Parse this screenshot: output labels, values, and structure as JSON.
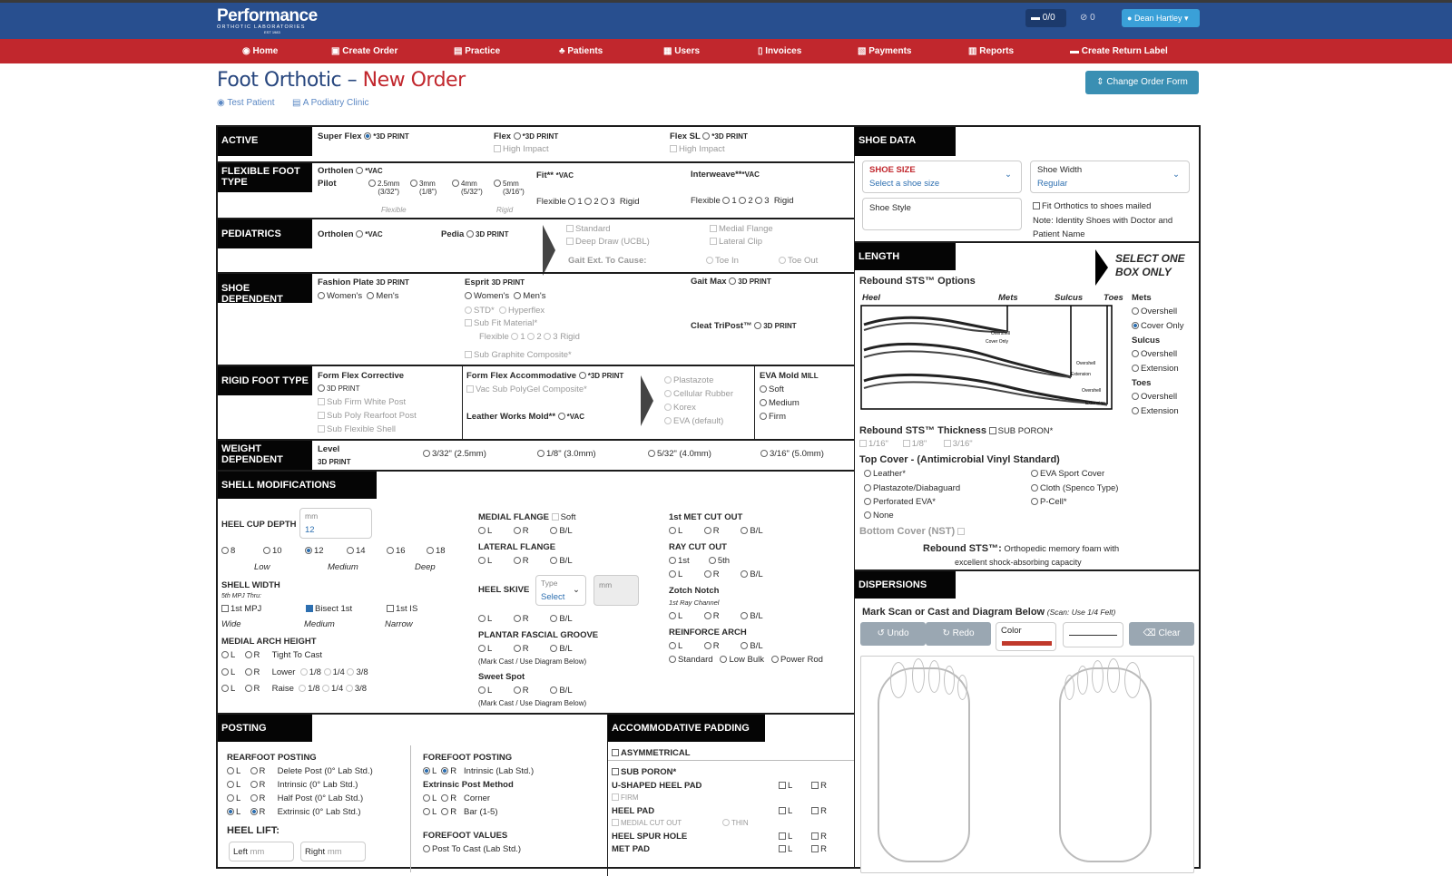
{
  "topbar": {
    "logo_line1": "Performance",
    "logo_line2": "ORTHOTIC LABORATORIES",
    "logo_line3": "EST 1983",
    "shipments": "0/0",
    "notifications": "0",
    "user": "Dean Hartley"
  },
  "nav": [
    "Home",
    "Create Order",
    "Practice",
    "Patients",
    "Users",
    "Invoices",
    "Payments",
    "Reports",
    "Create Return Label"
  ],
  "page": {
    "title": "Foot Orthotic",
    "subtitle": "New Order",
    "dash": "–",
    "patient": "Test Patient",
    "clinic": "A Podiatry Clinic",
    "change_form": "Change Order Form"
  },
  "active": {
    "header": "ACTIVE",
    "superflex": "Super Flex",
    "superflex_tag": "*3D PRINT",
    "flex": "Flex",
    "flex_tag": "*3D PRINT",
    "flexsl": "Flex SL",
    "flexsl_tag": "*3D PRINT",
    "high_impact": "High Impact"
  },
  "flexible": {
    "header": "FLEXIBLE FOOT TYPE",
    "ortholen": "Ortholen",
    "vac": "*VAC",
    "pilot": "Pilot",
    "m1": "2.5mm",
    "m1b": "(3/32\")",
    "m2": "3mm",
    "m2b": "(1/8\")",
    "m3": "4mm",
    "m3b": "(5/32\")",
    "m4": "5mm",
    "m4b": "(3/16\")",
    "flexible": "Flexible",
    "rigid": "Rigid",
    "fit": "Fit**",
    "fit_tag": "*VAC",
    "interweave": "Interweave**",
    "interweave_tag": "*VAC",
    "n1": "1",
    "n2": "2",
    "n3": "3"
  },
  "pediatrics": {
    "header": "PEDIATRICS",
    "ortholen": "Ortholen",
    "vac": "*VAC",
    "pedia": "Pedia",
    "pedia_tag": "3D PRINT",
    "standard": "Standard",
    "deep": "Deep Draw (UCBL)",
    "medial_flange": "Medial Flange",
    "lateral_clip": "Lateral Clip",
    "gait": "Gait Ext. To Cause:",
    "toe_in": "Toe In",
    "toe_out": "Toe Out"
  },
  "shoe_dep": {
    "header": "SHOE DEPENDENT",
    "fashion": "Fashion Plate",
    "print": "3D PRINT",
    "womens": "Women's",
    "mens": "Men's",
    "esprit": "Esprit",
    "std": "STD*",
    "hyperflex": "Hyperflex",
    "subfit": "Sub Fit Material*",
    "flexible": "Flexible",
    "rigid": "Rigid",
    "graphite": "Sub Graphite Composite*",
    "gaitmax": "Gait Max",
    "cleat": "Cleat TriPost™",
    "n1": "1",
    "n2": "2",
    "n3": "3"
  },
  "rigid": {
    "header": "RIGID FOOT TYPE",
    "formflex": "Form Flex Corrective",
    "print": "3D PRINT",
    "white": "Sub Firm White Post",
    "poly": "Sub Poly Rearfoot Post",
    "shell": "Sub Flexible Shell",
    "accom": "Form Flex Accommodative",
    "accom_tag": "*3D PRINT",
    "polygel": "Vac Sub PolyGel Composite*",
    "leather": "Leather Works Mold**",
    "vac": "*VAC",
    "plastazote": "Plastazote",
    "cellular": "Cellular Rubber",
    "korex": "Korex",
    "eva": "EVA (default)",
    "evamold": "EVA Mold",
    "mill": "MILL",
    "soft": "Soft",
    "medium": "Medium",
    "firm": "Firm"
  },
  "weight": {
    "header": "WEIGHT DEPENDENT",
    "level": "Level",
    "print": "3D PRINT",
    "o1": "3/32\" (2.5mm)",
    "o2": "1/8\" (3.0mm)",
    "o3": "5/32\" (4.0mm)",
    "o4": "3/16\" (5.0mm)"
  },
  "shellmod": {
    "header": "SHELL MODIFICATIONS",
    "heelcup": "HEEL CUP DEPTH",
    "mm": "mm",
    "heelcup_val": "12",
    "depths": [
      "8",
      "10",
      "12",
      "14",
      "16",
      "18"
    ],
    "low": "Low",
    "medium": "Medium",
    "deep": "Deep",
    "shellwidth": "SHELL WIDTH",
    "mpj": "5th MPJ Thru:",
    "w1": "1st MPJ",
    "w2": "Bisect 1st",
    "w3": "1st IS",
    "wide": "Wide",
    "narrow": "Narrow",
    "arch": "MEDIAL ARCH HEIGHT",
    "L": "L",
    "R": "R",
    "tight": "Tight To Cast",
    "lower": "Lower",
    "raise": "Raise",
    "f1": "1/8",
    "f2": "1/4",
    "f3": "3/8",
    "medflange": "MEDIAL FLANGE",
    "soft": "Soft",
    "BL": "B/L",
    "latflange": "LATERAL FLANGE",
    "skive": "HEEL SKIVE",
    "type": "Type",
    "select": "Select",
    "plantar": "PLANTAR FASCIAL GROOVE",
    "markcast": "(Mark Cast / Use Diagram Below)",
    "sweet": "Sweet Spot",
    "met1": "1st MET CUT OUT",
    "ray": "RAY CUT OUT",
    "r1": "1st",
    "r5": "5th",
    "zotch": "Zotch Notch",
    "raych": "1st Ray Channel",
    "reinforce": "REINFORCE ARCH",
    "standard": "Standard",
    "lowbulk": "Low Bulk",
    "power": "Power Rod"
  },
  "posting": {
    "header": "POSTING",
    "rearfoot": "REARFOOT POSTING",
    "delete": "Delete Post (0° Lab Std.)",
    "intrinsic": "Intrinsic (0° Lab Std.)",
    "half": "Half Post (0° Lab Std.)",
    "extrinsic": "Extrinsic (0° Lab Std.)",
    "heellift": "HEEL LIFT:",
    "left": "Left",
    "right": "Right",
    "mm": "mm",
    "forefoot": "FOREFOOT POSTING",
    "ff_intrinsic": "Intrinsic (Lab Std.)",
    "extmethod": "Extrinsic Post Method",
    "corner": "Corner",
    "bar": "Bar (1-5)",
    "ffvalues": "FOREFOOT VALUES",
    "posttocast": "Post To Cast (Lab Std.)",
    "L": "L",
    "R": "R"
  },
  "accom": {
    "header": "ACCOMMODATIVE PADDING",
    "asym": "ASYMMETRICAL",
    "poron": "SUB PORON*",
    "ushaped": "U-SHAPED HEEL PAD",
    "firm": "FIRM",
    "heelpad": "HEEL PAD",
    "medialcut": "MEDIAL CUT OUT",
    "thin": "THIN",
    "spur": "HEEL SPUR HOLE",
    "metpad": "MET PAD",
    "L": "L",
    "R": "R"
  },
  "shoedata": {
    "header": "SHOE DATA",
    "size_label": "SHOE SIZE",
    "size_val": "Select a shoe size",
    "width_label": "Shoe Width",
    "width_val": "Regular",
    "style": "Shoe Style",
    "fit": "Fit Orthotics to shoes mailed",
    "note": "Note: Identity Shoes with Doctor and Patient Name"
  },
  "length": {
    "header": "LENGTH",
    "select1": "SELECT ONE",
    "select2": "BOX ONLY",
    "options": "Rebound STS™ Options",
    "heel": "Heel",
    "mets": "Mets",
    "sulcus": "Sulcus",
    "toes": "Toes",
    "overshell": "Overshell",
    "coveronly": "Cover Only",
    "extension": "Extension",
    "thickness": "Rebound STS™ Thickness",
    "subporon": "SUB PORON*",
    "t1": "1/16\"",
    "t2": "1/8\"",
    "t3": "3/16\"",
    "topcover": "Top Cover - (Antimicrobial Vinyl Standard)",
    "leather": "Leather*",
    "plasta": "Plastazote/Diabaguard",
    "perf": "Perforated EVA*",
    "none": "None",
    "evasport": "EVA Sport Cover",
    "cloth": "Cloth (Spenco Type)",
    "pcell": "P-Cell*",
    "bottom": "Bottom Cover (NST)",
    "rebound": "Rebound STS™:",
    "rebound_desc": "Orthopedic memory foam with",
    "rebound_desc2": "excellent shock-absorbing capacity"
  },
  "dispersions": {
    "header": "DISPERSIONS",
    "mark": "Mark Scan or Cast and Diagram Below",
    "scan": "(Scan: Use 1/4 Felt)",
    "undo": "Undo",
    "redo": "Redo",
    "color": "Color",
    "clear": "Clear",
    "pen_color": "#c0392b"
  }
}
